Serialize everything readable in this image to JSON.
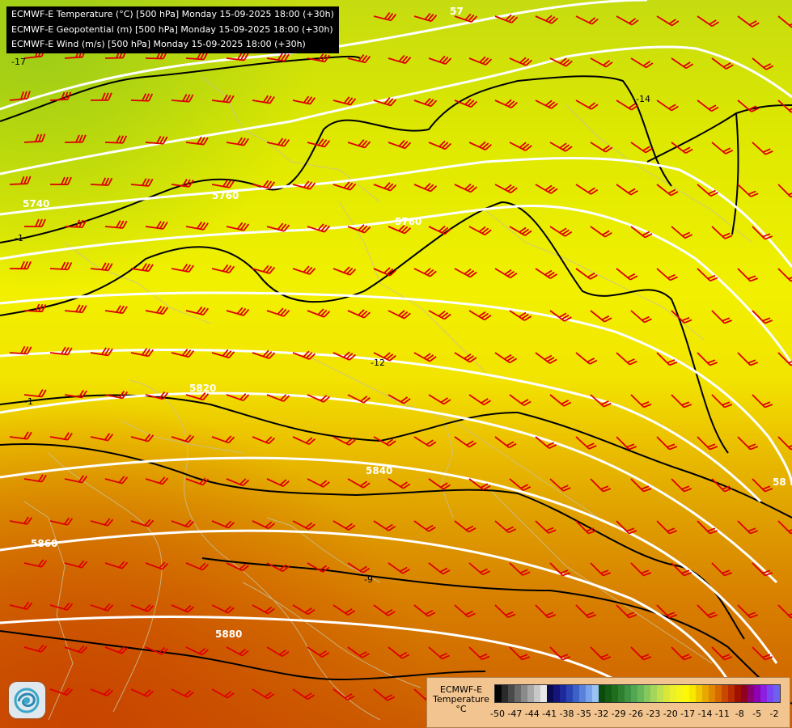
{
  "title_lines": [
    "ECMWF-E Temperature (°C) [500 hPa] Monday 15-09-2025 18:00 (+30h)",
    "ECMWF-E Geopotential (m) [500 hPa] Monday 15-09-2025 18:00 (+30h)",
    "ECMWF-E Wind (m/s) [500 hPa] Monday 15-09-2025 18:00 (+30h)"
  ],
  "geopotential_contours": {
    "color": "#ffffff",
    "labels": [
      "5740",
      "5760",
      "5760",
      "5820",
      "5840",
      "5860",
      "5880",
      "58"
    ],
    "partial_labels": [
      "57",
      "58"
    ]
  },
  "temperature_isotherms": {
    "color": "#000000",
    "labels": [
      "-14",
      "-12",
      "-1",
      "-1",
      "-9",
      "-17"
    ]
  },
  "wind_barbs": {
    "color": "#dd0000"
  },
  "legend": {
    "title_line1": "ECMWF-E",
    "title_line2": "Temperature",
    "unit": "°C",
    "colors": [
      "#050505",
      "#2a2a2a",
      "#4a4a4a",
      "#6a6a6a",
      "#8a8a8a",
      "#a8a8a8",
      "#c8c8c8",
      "#e8e8e8",
      "#0a0a50",
      "#14147a",
      "#1e2a9a",
      "#2a44b4",
      "#3c62c8",
      "#5a82dc",
      "#7aa2ea",
      "#9ac2f4",
      "#0a4a0a",
      "#145c14",
      "#1e6e1e",
      "#2e8030",
      "#3e9442",
      "#52a852",
      "#68b85a",
      "#86c85e",
      "#a4d65a",
      "#c0e050",
      "#d8e83a",
      "#ecf02a",
      "#f6f418",
      "#fcf808",
      "#f8e800",
      "#f0c800",
      "#e8a800",
      "#e08800",
      "#d86800",
      "#c84800",
      "#b82c00",
      "#a01000",
      "#900020",
      "#8a0070",
      "#8e00b4",
      "#8a20e0",
      "#7a44f0",
      "#6e60f0"
    ],
    "ticks": [
      "-50",
      "-47",
      "-44",
      "-41",
      "-38",
      "-35",
      "-32",
      "-29",
      "-26",
      "-23",
      "-20",
      "-17",
      "-14",
      "-11",
      "-8",
      "-5",
      "-2"
    ]
  },
  "logo_icon": "ecmwf-swirl-logo"
}
